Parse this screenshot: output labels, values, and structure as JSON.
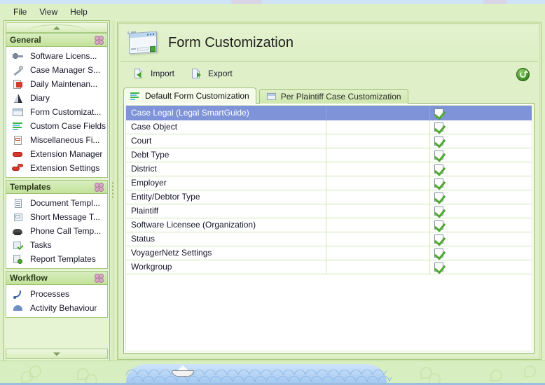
{
  "menubar": {
    "items": [
      "File",
      "View",
      "Help"
    ]
  },
  "sidebar": {
    "groups": [
      {
        "title": "General",
        "collapse_icon": "flower-icon",
        "items": [
          {
            "label": "Software Licens...",
            "icon": "key-icon"
          },
          {
            "label": "Case Manager S...",
            "icon": "wrench-icon"
          },
          {
            "label": "Daily Maintenan...",
            "icon": "maintenance-icon"
          },
          {
            "label": "Diary",
            "icon": "diary-icon"
          },
          {
            "label": "Form Customizat...",
            "icon": "form-icon"
          },
          {
            "label": "Custom Case Fields",
            "icon": "fields-icon"
          },
          {
            "label": "Miscellaneous Fi...",
            "icon": "misc-icon"
          },
          {
            "label": "Extension Manager",
            "icon": "extension-icon"
          },
          {
            "label": "Extension Settings",
            "icon": "extension-settings-icon"
          }
        ]
      },
      {
        "title": "Templates",
        "collapse_icon": "flower-icon",
        "items": [
          {
            "label": "Document Templ...",
            "icon": "document-icon"
          },
          {
            "label": "Short Message T...",
            "icon": "sms-icon"
          },
          {
            "label": "Phone Call Temp...",
            "icon": "phone-icon"
          },
          {
            "label": "Tasks",
            "icon": "task-icon"
          },
          {
            "label": "Report Templates",
            "icon": "report-icon"
          }
        ]
      },
      {
        "title": "Workflow",
        "collapse_icon": "flower-icon",
        "items": [
          {
            "label": "Processes",
            "icon": "process-icon"
          },
          {
            "label": "Activity Behaviour",
            "icon": "behaviour-icon"
          }
        ]
      }
    ]
  },
  "main": {
    "title": "Form Customization",
    "title_icon": "form-window-icon",
    "toolbar": {
      "import_label": "Import",
      "import_icon": "import-icon",
      "export_label": "Export",
      "export_icon": "export-icon",
      "refresh_icon": "refresh-icon"
    },
    "tabs": [
      {
        "label": "Default Form Customization",
        "icon": "fields-icon",
        "active": true
      },
      {
        "label": "Per Plaintiff Case Customization",
        "icon": "window-icon",
        "active": false
      }
    ],
    "table": {
      "rows": [
        {
          "name": "Case Legal (Legal SmartGuide)",
          "checked": true,
          "selected": true
        },
        {
          "name": "Case Object",
          "checked": true,
          "selected": false
        },
        {
          "name": "Court",
          "checked": true,
          "selected": false
        },
        {
          "name": "Debt Type",
          "checked": true,
          "selected": false
        },
        {
          "name": "District",
          "checked": true,
          "selected": false
        },
        {
          "name": "Employer",
          "checked": true,
          "selected": false
        },
        {
          "name": "Entity/Debtor Type",
          "checked": true,
          "selected": false
        },
        {
          "name": "Plaintiff",
          "checked": true,
          "selected": false
        },
        {
          "name": "Software Licensee (Organization)",
          "checked": true,
          "selected": false
        },
        {
          "name": "Status",
          "checked": true,
          "selected": false
        },
        {
          "name": "VoyagerNetz Settings",
          "checked": true,
          "selected": false
        },
        {
          "name": "Workgroup",
          "checked": true,
          "selected": false
        }
      ]
    }
  },
  "footer": {
    "decoration_icon": "paper-boat-icon"
  },
  "colors": {
    "background": "#dff0c8",
    "selection": "#7e93d8",
    "check": "#4fa832",
    "group_header_text": "#2b3a1c"
  }
}
